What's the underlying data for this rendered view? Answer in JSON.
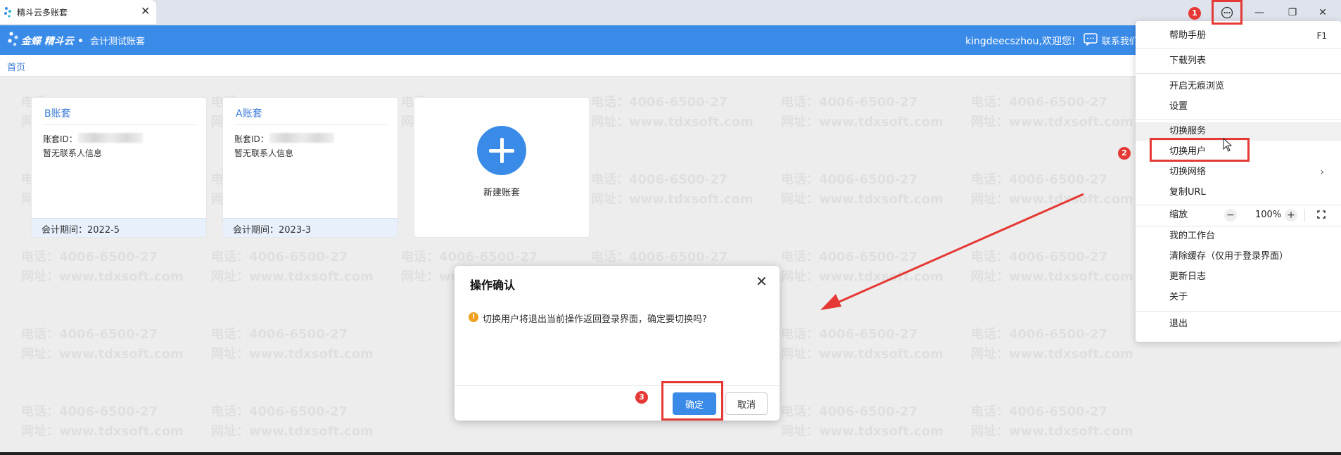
{
  "window": {
    "tab_title": "精斗云多账套",
    "tab_close": "✕",
    "minimize": "—",
    "restore": "❐",
    "close": "✕"
  },
  "header": {
    "brand": "金蝶 精斗云",
    "account": "会计测试账套",
    "welcome": "kingdeecszhou,欢迎您!",
    "contact": "联系我们"
  },
  "breadcrumb": {
    "home": "首页"
  },
  "watermark": {
    "phone": "电话：4006-6500-27",
    "site": "网址：www.tdxsoft.com"
  },
  "cards": [
    {
      "title": "B账套",
      "id_label": "账套ID：",
      "contact": "暂无联系人信息",
      "period": "会计期间：2022-5"
    },
    {
      "title": "A账套",
      "id_label": "账套ID：",
      "contact": "暂无联系人信息",
      "period": "会计期间：2023-3"
    }
  ],
  "new_card": {
    "label": "新建账套"
  },
  "dialog": {
    "title": "操作确认",
    "close": "✕",
    "warn_icon": "!",
    "message": "切换用户将退出当前操作返回登录界面，确定要切换吗?",
    "ok": "确定",
    "cancel": "取消"
  },
  "menu": {
    "items": {
      "help": "帮助手册",
      "help_shortcut": "F1",
      "downloads": "下载列表",
      "incognito": "开启无痕浏览",
      "settings": "设置",
      "switch_service": "切换服务",
      "switch_user": "切换用户",
      "switch_network": "切换网络",
      "copy_url": "复制URL",
      "zoom": "缩放",
      "zoom_minus": "−",
      "zoom_value": "100%",
      "zoom_plus": "+",
      "workbench": "我的工作台",
      "clear_cache": "清除缓存（仅用于登录界面）",
      "changelog": "更新日志",
      "about": "关于",
      "exit": "退出"
    }
  },
  "annotations": {
    "badge1": "1",
    "badge2": "2",
    "badge3": "3"
  },
  "colors": {
    "header_blue": "#3a8be8",
    "annotation_red": "#e53935",
    "warning_orange": "#f0a020"
  }
}
